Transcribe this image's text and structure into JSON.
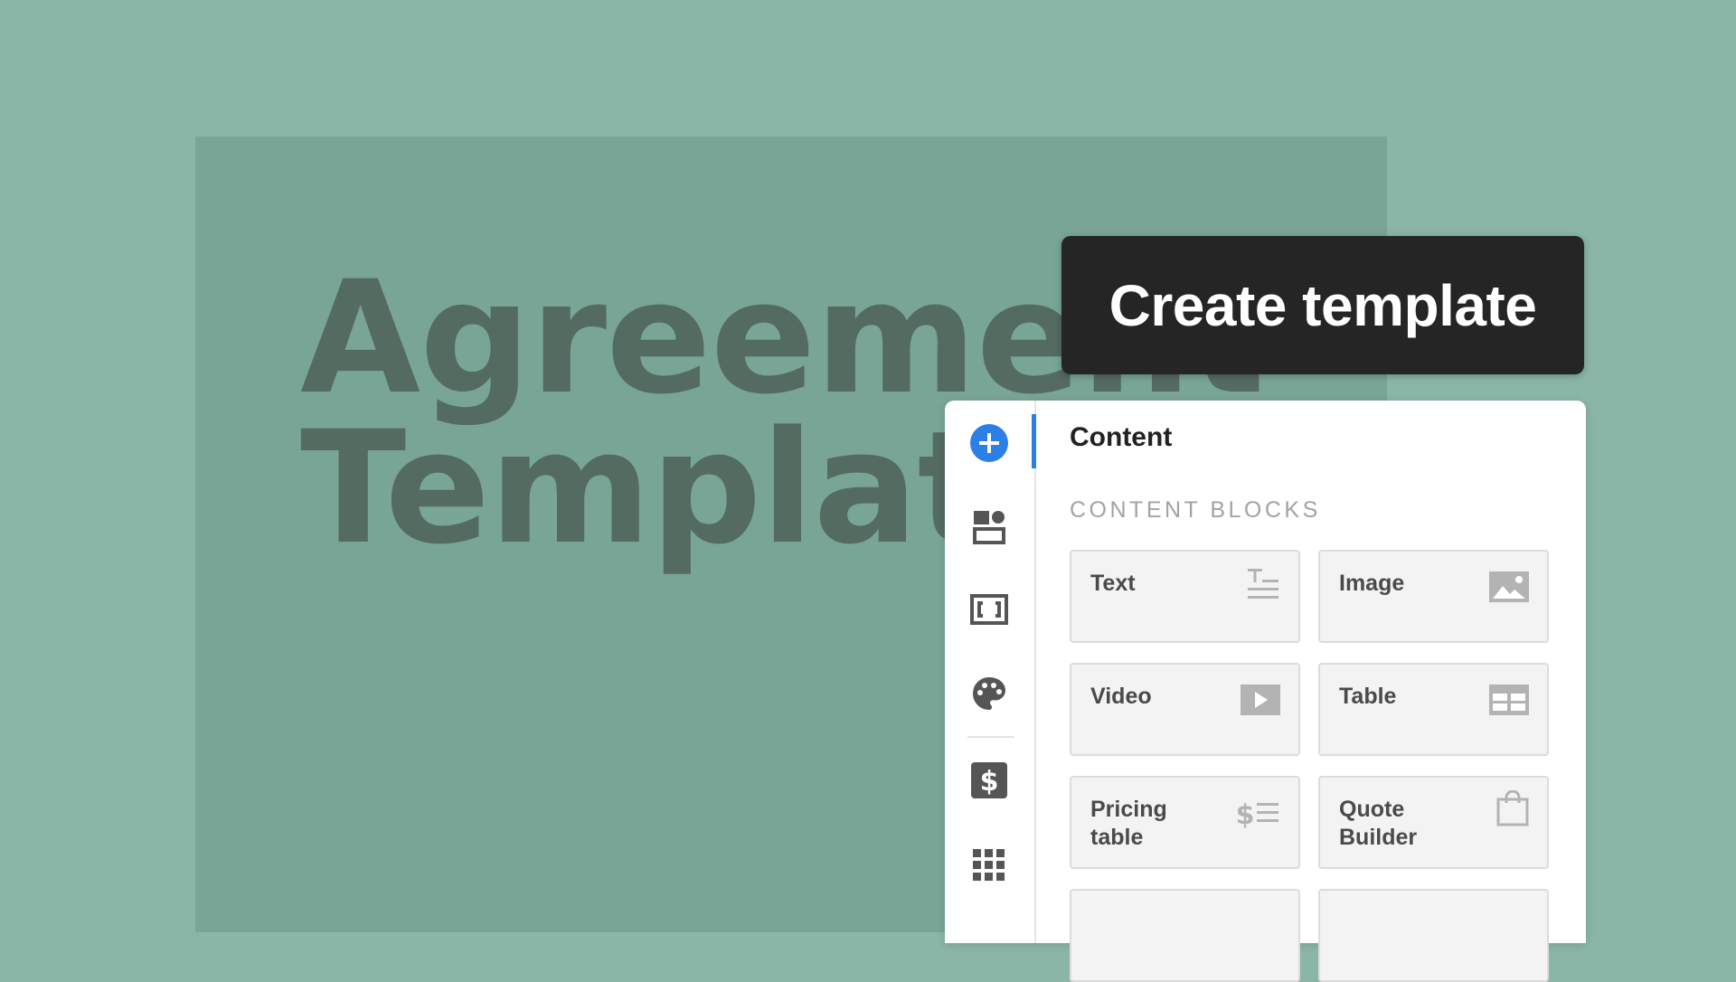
{
  "background_doc": {
    "title_lines": [
      "Agreement",
      "Template"
    ]
  },
  "tooltip": {
    "text": "Create template"
  },
  "panel": {
    "rail": [
      {
        "icon": "add-icon"
      },
      {
        "icon": "layout-blocks-icon"
      },
      {
        "icon": "frame-icon"
      },
      {
        "icon": "palette-icon"
      },
      {
        "icon": "pricing-dollar-icon"
      },
      {
        "icon": "apps-grid-icon"
      }
    ],
    "title": "Content",
    "section_label": "CONTENT BLOCKS",
    "blocks": [
      {
        "label": "Text",
        "icon": "text-block-icon"
      },
      {
        "label": "Image",
        "icon": "image-block-icon"
      },
      {
        "label": "Video",
        "icon": "video-block-icon"
      },
      {
        "label": "Table",
        "icon": "table-block-icon"
      },
      {
        "label": "Pricing\ntable",
        "icon": "pricing-table-icon"
      },
      {
        "label": "Quote\nBuilder",
        "icon": "quote-builder-icon"
      }
    ]
  },
  "colors": {
    "accent": "#2d7fe8",
    "background": "#8ab5a7",
    "tooltip": "#252525"
  }
}
